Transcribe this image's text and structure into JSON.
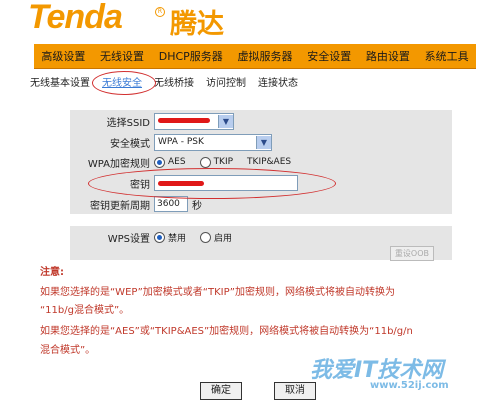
{
  "logo": {
    "brand": "Tenda",
    "cn": "腾达"
  },
  "nav": [
    "高级设置",
    "无线设置",
    "DHCP服务器",
    "虚拟服务器",
    "安全设置",
    "路由设置",
    "系统工具"
  ],
  "subnav": [
    "无线基本设置",
    "无线安全",
    "无线桥接",
    "访问控制",
    "连接状态"
  ],
  "form": {
    "ssid_label": "选择SSID",
    "security_label": "安全模式",
    "security_value": "WPA - PSK",
    "wpa_rule_label": "WPA加密规则",
    "wpa_options": [
      "AES",
      "TKIP",
      "TKIP&AES"
    ],
    "key_label": "密钥",
    "renew_label": "密钥更新周期",
    "renew_value": "3600",
    "renew_unit": "秒",
    "wps_label": "WPS设置",
    "wps_options": [
      "禁用",
      "启用"
    ],
    "reset_oob": "重设OOB"
  },
  "note": {
    "title": "注意:",
    "line1": "如果您选择的是“WEP”加密模式或者“TKIP”加密规则，网络模式将被自动转换为",
    "line2": "“11b/g混合模式”。",
    "line3": "如果您选择的是“AES”或“TKIP&AES”加密规则，网络模式将被自动转换为“11b/g/n",
    "line4": "混合模式”。"
  },
  "buttons": {
    "ok": "确定",
    "cancel": "取消"
  },
  "watermark": {
    "main": "我爱IT技术网",
    "url": "www.52ij.com"
  },
  "colors": {
    "accent": "#f39800",
    "panel": "#e5e5e5",
    "note": "#c0392b"
  }
}
